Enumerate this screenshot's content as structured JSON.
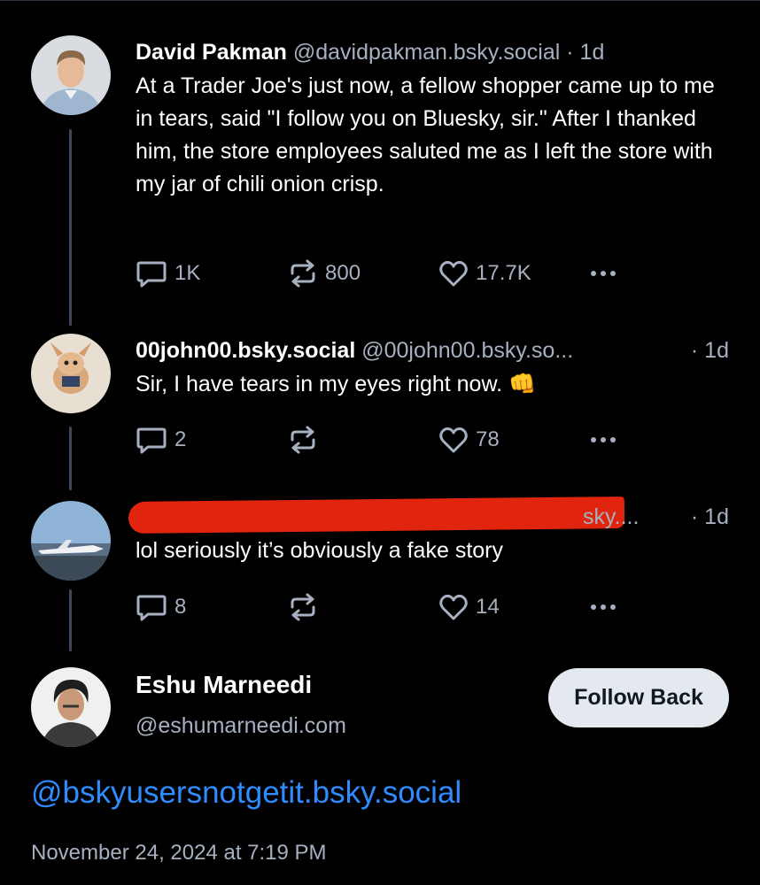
{
  "posts": [
    {
      "name": "David Pakman",
      "handle": "@davidpakman.bsky.social",
      "time": "· 1d",
      "text": "At a Trader Joe's just now, a fellow shopper came up to me in tears, said \"I follow you on Bluesky, sir.\" After I thanked him, the store employees saluted me as I left the store with my jar of chili onion crisp.",
      "replies": "1K",
      "reposts": "800",
      "likes": "17.7K"
    },
    {
      "name": "00john00.bsky.social",
      "handle": "@00john00.bsky.so...",
      "time": "· 1d",
      "text": "Sir, I have tears in my eyes right now. 👊",
      "replies": "2",
      "reposts": "",
      "likes": "78"
    },
    {
      "handle_visible": "sky....",
      "time": "· 1d",
      "text": "lol seriously it’s obviously a fake story",
      "replies": "8",
      "reposts": "",
      "likes": "14"
    }
  ],
  "profile": {
    "name": "Eshu Marneedi",
    "handle": "@eshumarneedi.com",
    "button": "Follow Back"
  },
  "reply_mention": "@bskyusersnotgetit.bsky.social",
  "timestamp": "November 24, 2024 at 7:19 PM",
  "colors": {
    "background": "#000000",
    "muted": "#a6b0c0",
    "link": "#2f8cff",
    "redaction": "#e1240e"
  },
  "icons": [
    "reply-icon",
    "repost-icon",
    "like-icon",
    "more-icon"
  ]
}
